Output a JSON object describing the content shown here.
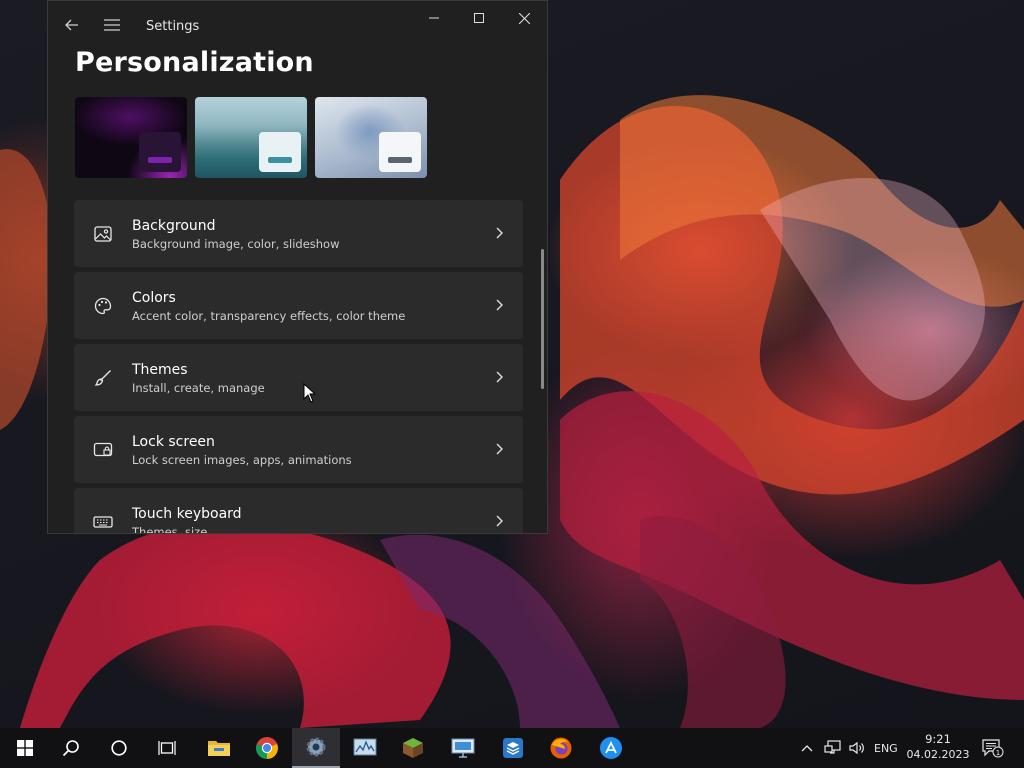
{
  "window": {
    "app_title": "Settings",
    "page_title": "Personalization"
  },
  "themes": [
    {
      "name": "theme-dark-purple",
      "accent": "#7b22b0"
    },
    {
      "name": "theme-lake",
      "accent": "#3c8fa1"
    },
    {
      "name": "theme-bloom-light",
      "accent": "#5a6472"
    }
  ],
  "settings_items": [
    {
      "label": "Background",
      "description": "Background image, color, slideshow",
      "icon": "image-icon"
    },
    {
      "label": "Colors",
      "description": "Accent color, transparency effects, color theme",
      "icon": "palette-icon"
    },
    {
      "label": "Themes",
      "description": "Install, create, manage",
      "icon": "brush-icon"
    },
    {
      "label": "Lock screen",
      "description": "Lock screen images, apps, animations",
      "icon": "lock-screen-icon"
    },
    {
      "label": "Touch keyboard",
      "description": "Themes, size",
      "icon": "keyboard-icon"
    }
  ],
  "taskbar": {
    "apps": [
      "start-icon",
      "search-icon",
      "cortana-icon",
      "task-view-icon",
      "file-explorer-icon",
      "chrome-icon",
      "settings-icon",
      "resource-monitor-icon",
      "minecraft-icon",
      "remote-desktop-icon",
      "box-app-icon",
      "firefox-icon",
      "app-store-icon"
    ],
    "active_app": "settings-icon"
  },
  "tray": {
    "language": "ENG",
    "time": "9:21",
    "date": "04.02.2023",
    "notification_count": "1"
  }
}
